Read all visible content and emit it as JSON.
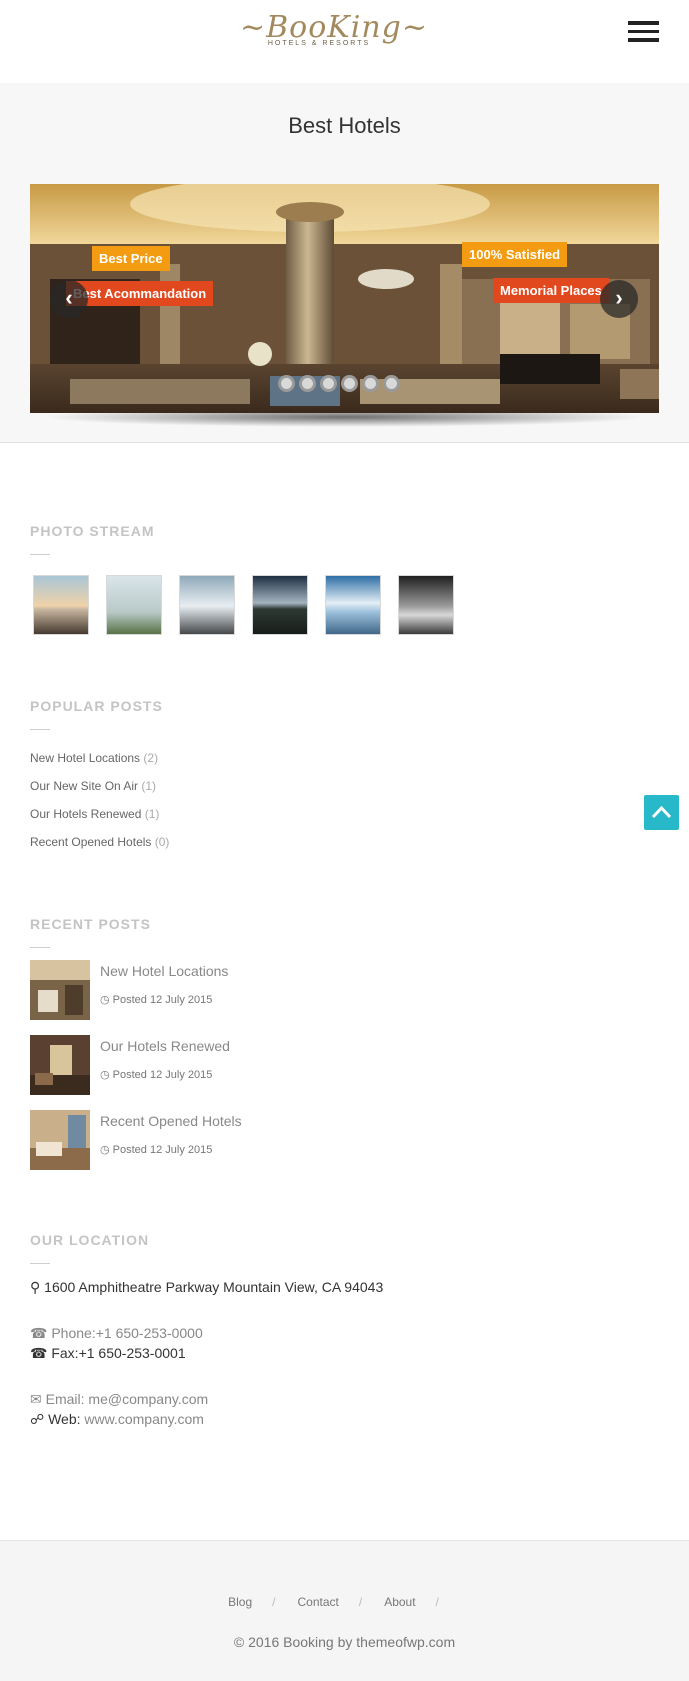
{
  "header": {
    "logo_main": "~BooKing~",
    "logo_sub": "HOTELS & RESORTS",
    "menu_icon": "hamburger-icon"
  },
  "hero": {
    "title": "Best Hotels",
    "captions": {
      "best_price": "Best Price",
      "best_accommodation": "Best Acommandation",
      "satisfied": "100% Satisfied",
      "memorial": "Memorial Places"
    },
    "prev_icon": "chevron-left-icon",
    "next_icon": "chevron-right-icon",
    "slide_count": 6
  },
  "photo_stream": {
    "title": "PHOTO STREAM"
  },
  "popular_posts": {
    "title": "POPULAR POSTS",
    "items": [
      {
        "label": "New Hotel Locations",
        "count": "(2)"
      },
      {
        "label": "Our New Site On Air",
        "count": "(1)"
      },
      {
        "label": "Our Hotels Renewed",
        "count": "(1)"
      },
      {
        "label": "Recent Opened Hotels",
        "count": "(0)"
      }
    ]
  },
  "recent_posts": {
    "title": "RECENT POSTS",
    "items": [
      {
        "title": "New Hotel Locations",
        "date": "Posted 12 July 2015"
      },
      {
        "title": "Our Hotels Renewed",
        "date": "Posted 12 July 2015"
      },
      {
        "title": "Recent Opened Hotels",
        "date": "Posted 12 July 2015"
      }
    ]
  },
  "location": {
    "title": "OUR LOCATION",
    "address": "1600 Amphitheatre Parkway Mountain View, CA 94043",
    "phone": "Phone:+1 650-253-0000",
    "fax": "Fax:+1 650-253-0001",
    "email": "Email: me@company.com",
    "web_label": "Web:",
    "web_value": "www.company.com"
  },
  "footer": {
    "nav": [
      "Blog",
      "Contact",
      "About"
    ],
    "separator": "/",
    "copyright": "© 2016 Booking by themeofwp.com"
  },
  "colors": {
    "accent_orange": "#f39c12",
    "accent_red": "#e2481e",
    "to_top": "#27b8c9",
    "logo_gold": "#a38a5e"
  }
}
